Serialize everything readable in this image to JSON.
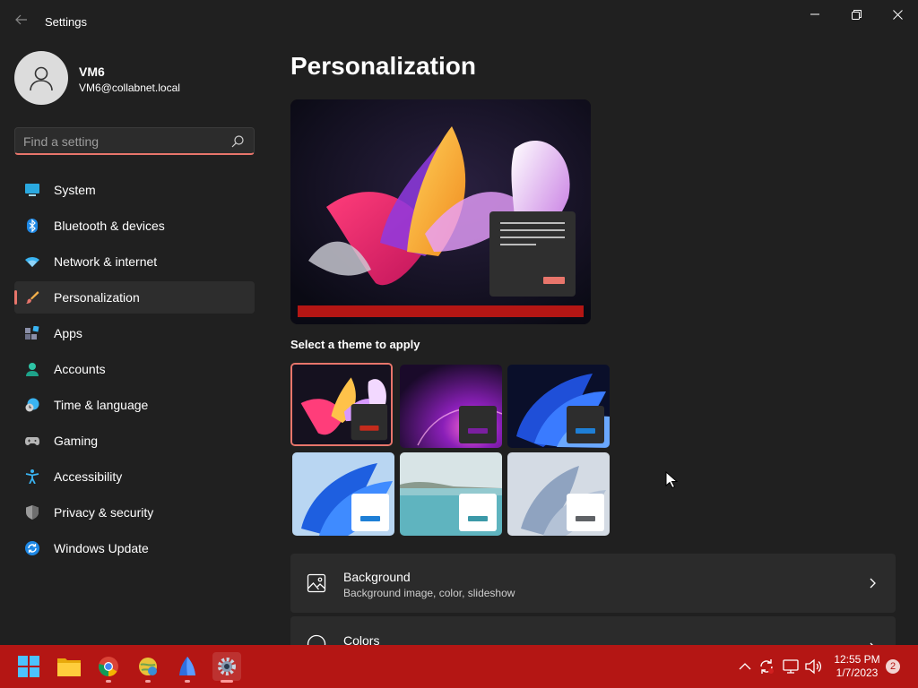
{
  "window": {
    "title": "Settings"
  },
  "user": {
    "name": "VM6",
    "email": "VM6@collabnet.local"
  },
  "search": {
    "placeholder": "Find a setting"
  },
  "sidebar": {
    "items": [
      {
        "label": "System",
        "icon": "system-icon"
      },
      {
        "label": "Bluetooth & devices",
        "icon": "bluetooth-icon"
      },
      {
        "label": "Network & internet",
        "icon": "wifi-icon"
      },
      {
        "label": "Personalization",
        "icon": "brush-icon",
        "selected": true
      },
      {
        "label": "Apps",
        "icon": "apps-icon"
      },
      {
        "label": "Accounts",
        "icon": "accounts-icon"
      },
      {
        "label": "Time & language",
        "icon": "clock-globe-icon"
      },
      {
        "label": "Gaming",
        "icon": "gamepad-icon"
      },
      {
        "label": "Accessibility",
        "icon": "accessibility-icon"
      },
      {
        "label": "Privacy & security",
        "icon": "shield-icon"
      },
      {
        "label": "Windows Update",
        "icon": "update-icon"
      }
    ]
  },
  "main": {
    "title": "Personalization",
    "themes_label": "Select a theme to apply",
    "themes": [
      {
        "name": "glow-red",
        "accent": "#c42b1c",
        "selected": true
      },
      {
        "name": "purple-flow",
        "accent": "#7a1fa0"
      },
      {
        "name": "blue-bloom-dark",
        "accent": "#1e7fd6"
      },
      {
        "name": "blue-bloom-light",
        "accent": "#1e7fd6"
      },
      {
        "name": "lake",
        "accent": "#3b99a8"
      },
      {
        "name": "captured-motion",
        "accent": "#5f6266"
      }
    ],
    "cards": [
      {
        "title": "Background",
        "subtitle": "Background image, color, slideshow",
        "icon": "picture-icon"
      },
      {
        "title": "Colors",
        "subtitle": "",
        "icon": "palette-icon"
      }
    ]
  },
  "taskbar": {
    "apps": [
      {
        "name": "start-icon"
      },
      {
        "name": "file-explorer-icon"
      },
      {
        "name": "chrome-icon"
      },
      {
        "name": "app-globe-icon"
      },
      {
        "name": "app-blue-icon"
      },
      {
        "name": "settings-gear-icon",
        "active": true
      }
    ],
    "time": "12:55 PM",
    "date": "1/7/2023",
    "notifications": "2"
  },
  "colors": {
    "accent": "#e8756b",
    "taskbar": "#b41614",
    "background": "#202020"
  }
}
